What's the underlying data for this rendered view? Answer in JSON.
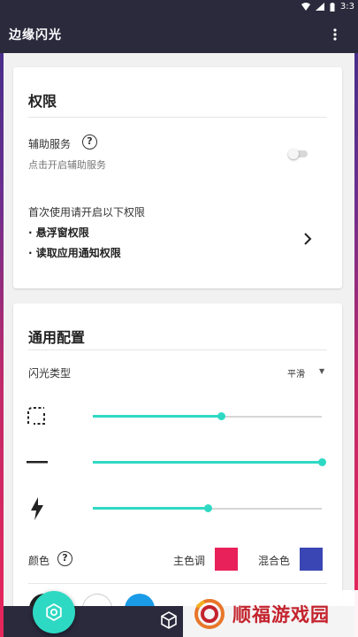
{
  "status_bar": {
    "time": "3:3"
  },
  "app_bar": {
    "title": "边缘闪光",
    "menu_icon": "more-vert-icon"
  },
  "permissions_card": {
    "title": "权限",
    "accessibility": {
      "label": "辅助服务",
      "hint": "点击开启辅助服务",
      "enabled": false
    },
    "first_use": {
      "intro": "首次使用请开启以下权限",
      "items": [
        "· 悬浮窗权限",
        "· 读取应用通知权限"
      ]
    }
  },
  "general_card": {
    "title": "通用配置",
    "flash_type": {
      "label": "闪光类型",
      "value": "平滑"
    },
    "sliders": [
      {
        "icon": "corner-radius-icon",
        "value": 0.56
      },
      {
        "icon": "line-width-icon",
        "value": 1.0
      },
      {
        "icon": "flash-speed-icon",
        "value": 0.5
      }
    ],
    "colors": {
      "label": "颜色",
      "primary_label": "主色调",
      "primary_color": "#e8215a",
      "mix_label": "混合色",
      "mix_color": "#3a46b3"
    }
  },
  "fab": {
    "icon": "settings-icon"
  },
  "watermark": {
    "text": "顺福游戏园"
  }
}
